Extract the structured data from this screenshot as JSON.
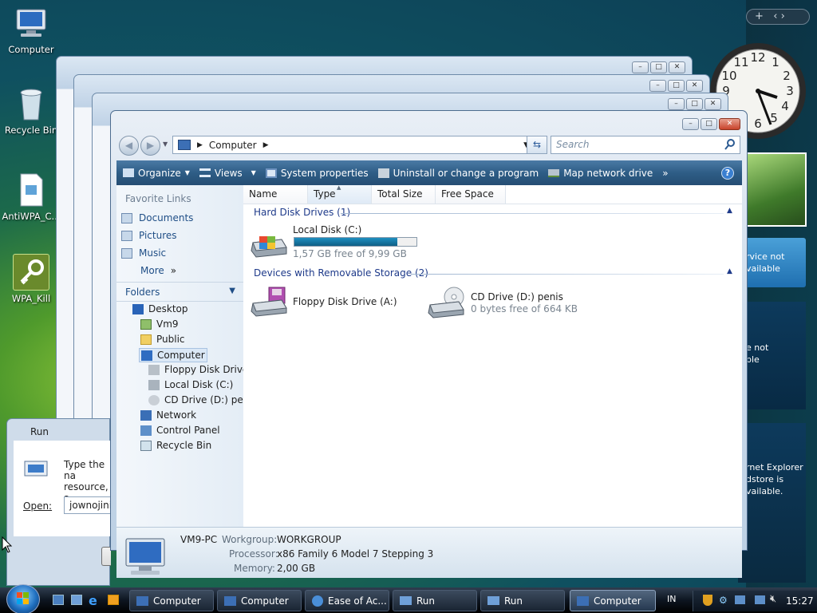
{
  "desktop": {
    "icons": [
      {
        "label": "Computer"
      },
      {
        "label": "Recycle Bin"
      },
      {
        "label": "AntiWPA_C..."
      },
      {
        "label": "WPA_Kill"
      }
    ]
  },
  "sidebar": {
    "gadget1_lines": [
      "rvice not",
      "vailable"
    ],
    "gadget2_lines": [
      "e not",
      "ble"
    ],
    "gadget3_lines": [
      "rnet Explorer",
      "dstore is",
      "vailable."
    ]
  },
  "window": {
    "address": {
      "location": "Computer"
    },
    "search": {
      "placeholder": "Search"
    },
    "toolbar": {
      "organize": "Organize",
      "views": "Views",
      "system_properties": "System properties",
      "uninstall": "Uninstall or change a program",
      "map_drive": "Map network drive",
      "more": "»",
      "help": "?"
    },
    "nav": {
      "favorite_links_title": "Favorite Links",
      "favorites": [
        {
          "label": "Documents"
        },
        {
          "label": "Pictures"
        },
        {
          "label": "Music"
        }
      ],
      "more": "More",
      "folders_title": "Folders",
      "tree": [
        {
          "label": "Desktop"
        },
        {
          "label": "Vm9"
        },
        {
          "label": "Public"
        },
        {
          "label": "Computer"
        },
        {
          "label": "Floppy Disk Drive"
        },
        {
          "label": "Local Disk (C:)"
        },
        {
          "label": "CD Drive (D:) peni"
        },
        {
          "label": "Network"
        },
        {
          "label": "Control Panel"
        },
        {
          "label": "Recycle Bin"
        }
      ]
    },
    "columns": [
      "Name",
      "Type",
      "Total Size",
      "Free Space"
    ],
    "groups": {
      "hard_disk": "Hard Disk Drives (1)",
      "removable": "Devices with Removable Storage (2)"
    },
    "drives": {
      "local_c": {
        "name": "Local Disk (C:)",
        "free": "1,57 GB free of 9,99 GB",
        "used_fraction": 0.843,
        "bar_color": "#1f8fc0"
      },
      "floppy": {
        "name": "Floppy Disk Drive (A:)"
      },
      "cd": {
        "name": "CD Drive (D:) penis",
        "free": "0 bytes free of 664 KB"
      }
    },
    "details": {
      "computer_name": "VM9-PC",
      "workgroup_label": "Workgroup:",
      "workgroup": "WORKGROUP",
      "processor_label": "Processor:",
      "processor": "x86 Family 6 Model 7 Stepping 3",
      "memory_label": "Memory:",
      "memory": "2,00 GB"
    }
  },
  "run_dialog": {
    "title": "Run",
    "text_line1": "Type the na",
    "text_line2": "resource, a",
    "open_label": "Open:",
    "open_value": "jownojiniv"
  },
  "taskbar": {
    "tasks": [
      {
        "label": "Computer"
      },
      {
        "label": "Computer"
      },
      {
        "label": "Ease of Ac..."
      },
      {
        "label": "Run"
      },
      {
        "label": "Run"
      },
      {
        "label": "Computer"
      }
    ],
    "language": "IN",
    "clock": "15:27"
  }
}
